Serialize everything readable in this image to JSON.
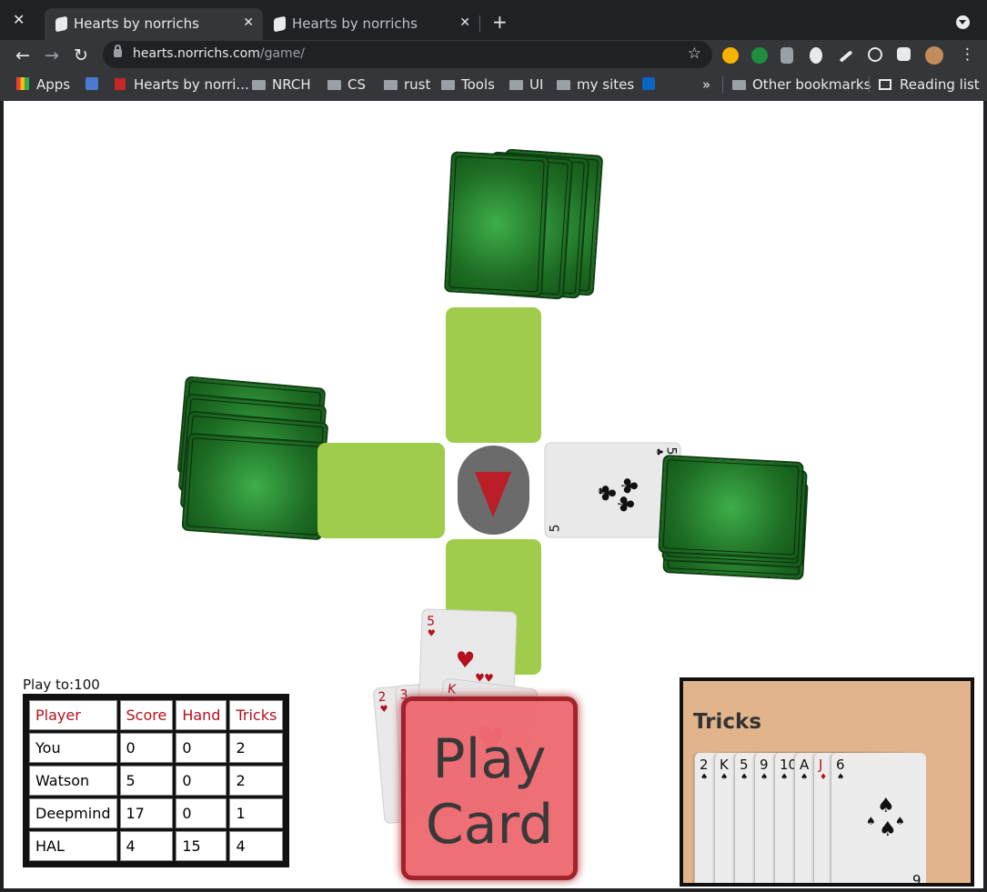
{
  "browser": {
    "tabs": [
      {
        "title": "Hearts by norrichs",
        "active": true
      },
      {
        "title": "Hearts by norrichs",
        "active": false
      }
    ],
    "url": {
      "domain": "hearts.norrichs.com",
      "path": "/game/"
    },
    "bookmarks": [
      "Apps",
      "Hearts by norri...",
      "NRCH",
      "CS",
      "rust",
      "Tools",
      "UI",
      "my sites"
    ],
    "other_bookmarks": "Other bookmarks",
    "reading_list": "Reading list",
    "overflow": "»"
  },
  "game": {
    "play_to_label": "Play to:100",
    "play_button_line1": "Play",
    "play_button_line2": "Card",
    "played_card_east": {
      "rank": "5",
      "suit": "clubs",
      "symbol": "♣"
    },
    "hand": [
      {
        "rank": "2",
        "suit": "hearts",
        "symbol": "♥"
      },
      {
        "rank": "3",
        "suit": "hearts",
        "symbol": "♥"
      },
      {
        "rank": "5",
        "suit": "hearts",
        "symbol": "♥"
      },
      {
        "rank": "K",
        "suit": "hearts",
        "symbol": "♥"
      }
    ],
    "scoreboard": {
      "headers": [
        "Player",
        "Score",
        "Hand",
        "Tricks"
      ],
      "rows": [
        [
          "You",
          "0",
          "0",
          "2"
        ],
        [
          "Watson",
          "5",
          "0",
          "2"
        ],
        [
          "Deepmind",
          "17",
          "0",
          "1"
        ],
        [
          "HAL",
          "4",
          "15",
          "4"
        ]
      ]
    },
    "tricks": {
      "title": "Tricks",
      "cards": [
        {
          "rank": "2",
          "symbol": "♠",
          "color": "black"
        },
        {
          "rank": "K",
          "symbol": "♠",
          "color": "black"
        },
        {
          "rank": "5",
          "symbol": "♠",
          "color": "black"
        },
        {
          "rank": "9",
          "symbol": "♠",
          "color": "black"
        },
        {
          "rank": "10",
          "symbol": "♠",
          "color": "black"
        },
        {
          "rank": "A",
          "symbol": "♠",
          "color": "black"
        },
        {
          "rank": "J",
          "symbol": "♦",
          "color": "red"
        },
        {
          "rank": "6",
          "symbol": "♠",
          "color": "black"
        }
      ]
    }
  },
  "colors": {
    "felt_green": "#1e6e24",
    "slot_green": "#9fcc4b",
    "turn_arrow": "#bb1e28",
    "play_button": "#ee6b71",
    "tricks_panel": "#e1b48b"
  }
}
